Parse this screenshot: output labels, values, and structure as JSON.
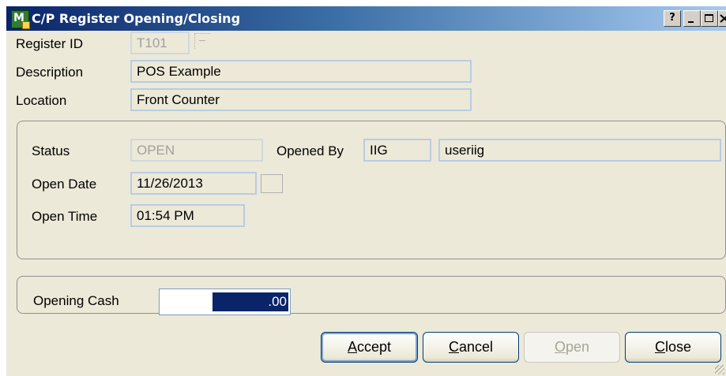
{
  "window": {
    "title": "C/P Register Opening/Closing",
    "help_label": "?",
    "app_icon_label": "M"
  },
  "form": {
    "register_id": {
      "label": "Register ID",
      "value": "T101"
    },
    "description": {
      "label": "Description",
      "value": "POS Example"
    },
    "location": {
      "label": "Location",
      "value": "Front Counter"
    }
  },
  "status_group": {
    "status": {
      "label": "Status",
      "value": "OPEN"
    },
    "opened_by": {
      "label": "Opened By",
      "code": "IIG",
      "name": "useriig"
    },
    "open_date": {
      "label": "Open Date",
      "value": "11/26/2013"
    },
    "open_time": {
      "label": "Open Time",
      "value": "01:54 PM"
    }
  },
  "cash_group": {
    "opening_cash": {
      "label": "Opening Cash",
      "value": ".00"
    }
  },
  "buttons": {
    "accept": {
      "accel": "A",
      "rest": "ccept"
    },
    "cancel": {
      "accel": "C",
      "rest": "ancel"
    },
    "open": {
      "accel": "O",
      "rest": "pen",
      "enabled": false
    },
    "close": {
      "accel": "C",
      "rest": "lose"
    }
  },
  "colors": {
    "titlebar_start": "#0a246a",
    "titlebar_end": "#a6caf0",
    "window_bg": "#ece9d8",
    "selection": "#0a246a"
  },
  "icons": [
    "app-icon",
    "help-icon",
    "minimize-icon",
    "maximize-icon",
    "close-icon",
    "lookup-icon",
    "calendar-icon",
    "resize-grip-icon"
  ]
}
